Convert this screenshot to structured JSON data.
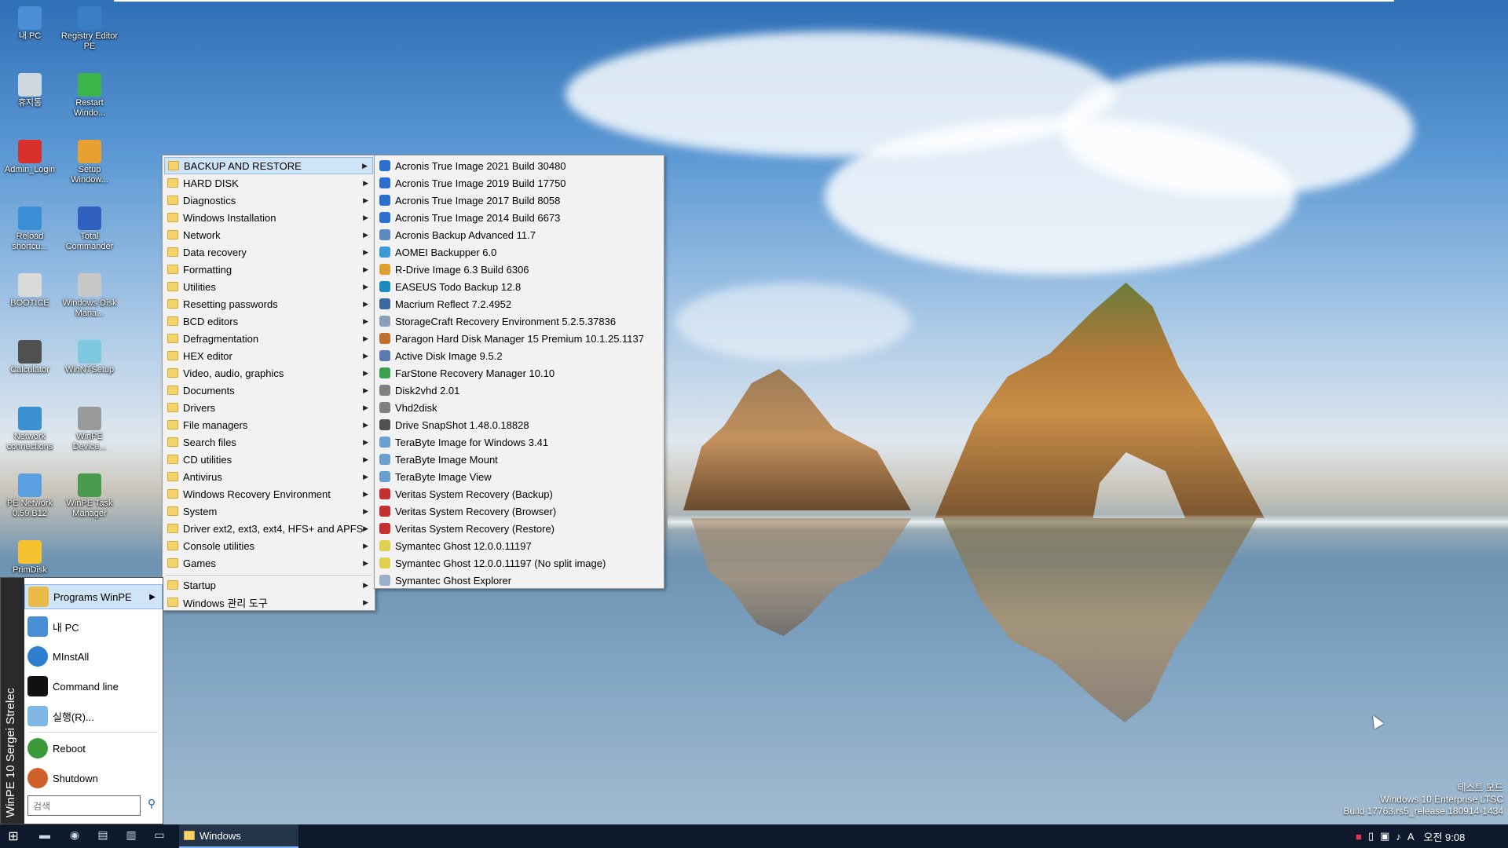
{
  "desktop": {
    "icons": [
      {
        "label": "내 PC",
        "icon": "computer-icon",
        "color": "#4a8fd6"
      },
      {
        "label": "Registry Editor PE",
        "icon": "registry-icon",
        "color": "#3a7fc4"
      },
      {
        "label": "휴지통",
        "icon": "recycle-bin-icon",
        "color": "#cfd8e0"
      },
      {
        "label": "Restart Windo...",
        "icon": "restart-icon",
        "color": "#3bb54a"
      },
      {
        "label": "Admin_Login",
        "icon": "admin-icon",
        "color": "#d9302c"
      },
      {
        "label": "Setup Window...",
        "icon": "setup-icon",
        "color": "#e8a030"
      },
      {
        "label": "Reload shortcu...",
        "icon": "reload-icon",
        "color": "#3a8fd6"
      },
      {
        "label": "Total Commander",
        "icon": "floppy-icon",
        "color": "#3060c0"
      },
      {
        "label": "BOOTICE",
        "icon": "bootice-icon",
        "color": "#dadada"
      },
      {
        "label": "Windows Disk Mana...",
        "icon": "disk-icon",
        "color": "#c8c8c8"
      },
      {
        "label": "Calculator",
        "icon": "calculator-icon",
        "color": "#505050"
      },
      {
        "label": "WinNTSetup",
        "icon": "winntsetup-icon",
        "color": "#7ec9e0"
      },
      {
        "label": "Network connections",
        "icon": "network-icon",
        "color": "#3a90d0"
      },
      {
        "label": "WinPE Device...",
        "icon": "device-icon",
        "color": "#9a9a9a"
      },
      {
        "label": "PE Network 0.59.B12",
        "icon": "pe-network-icon",
        "color": "#5a9fe0"
      },
      {
        "label": "WinPE Task Manager",
        "icon": "task-manager-icon",
        "color": "#4a9a50"
      },
      {
        "label": "PrimDisk",
        "icon": "cd-icon",
        "color": "#f5c330"
      }
    ]
  },
  "start_menu": {
    "side_label": "WinPE 10 Sergei Strelec",
    "items": [
      {
        "label": "Programs WinPE",
        "icon": "programs-icon"
      },
      {
        "label": "내 PC",
        "icon": "computer-icon"
      },
      {
        "label": "MInstAll",
        "icon": "minstall-icon"
      },
      {
        "label": "Command line",
        "icon": "cmd-icon"
      },
      {
        "label": "실행(R)...",
        "icon": "run-icon"
      },
      {
        "label": "Reboot",
        "icon": "reboot-icon"
      },
      {
        "label": "Shutdown",
        "icon": "shutdown-icon"
      }
    ],
    "search_placeholder": "검색"
  },
  "categories_menu": {
    "items": [
      "BACKUP AND RESTORE",
      "HARD DISK",
      "Diagnostics",
      "Windows Installation",
      "Network",
      "Data recovery",
      "Formatting",
      "Utilities",
      "Resetting passwords",
      "BCD editors",
      "Defragmentation",
      "HEX editor",
      "Video, audio, graphics",
      "Documents",
      "Drivers",
      "File managers",
      "Search files",
      "CD utilities",
      "Antivirus",
      "Windows Recovery Environment",
      "System",
      "Driver ext2, ext3, ext4, HFS+ and APFS",
      "Console utilities",
      "Games"
    ],
    "extra_items": [
      "Startup",
      "Windows 관리 도구"
    ]
  },
  "backup_menu": {
    "items": [
      {
        "label": "Acronis True Image 2021 Build 30480",
        "icon": "acronis-icon",
        "color": "#2a6fd0"
      },
      {
        "label": "Acronis True Image 2019 Build 17750",
        "icon": "acronis-icon",
        "color": "#2a6fd0"
      },
      {
        "label": "Acronis True Image 2017 Build 8058",
        "icon": "acronis-icon",
        "color": "#2a6fd0"
      },
      {
        "label": "Acronis True Image 2014 Build 6673",
        "icon": "acronis-icon",
        "color": "#2a6fd0"
      },
      {
        "label": "Acronis Backup Advanced 11.7",
        "icon": "acronis-backup-icon",
        "color": "#5a8ac0"
      },
      {
        "label": "AOMEI Backupper 6.0",
        "icon": "aomei-icon",
        "color": "#3a9ad6"
      },
      {
        "label": "R-Drive Image 6.3 Build 6306",
        "icon": "rdrive-icon",
        "color": "#e0a030"
      },
      {
        "label": "EASEUS Todo Backup 12.8",
        "icon": "easeus-icon",
        "color": "#1a8ac0"
      },
      {
        "label": "Macrium Reflect 7.2.4952",
        "icon": "macrium-icon",
        "color": "#3a6aa0"
      },
      {
        "label": "StorageCraft Recovery Environment 5.2.5.37836",
        "icon": "storagecraft-icon",
        "color": "#8aa0b8"
      },
      {
        "label": "Paragon Hard Disk Manager 15 Premium 10.1.25.1137",
        "icon": "paragon-icon",
        "color": "#c0702a"
      },
      {
        "label": "Active Disk Image 9.5.2",
        "icon": "active-disk-icon",
        "color": "#5a7ab0"
      },
      {
        "label": "FarStone Recovery Manager 10.10",
        "icon": "farstone-icon",
        "color": "#3aa050"
      },
      {
        "label": "Disk2vhd 2.01",
        "icon": "disk2vhd-icon",
        "color": "#808080"
      },
      {
        "label": "Vhd2disk",
        "icon": "vhd2disk-icon",
        "color": "#808080"
      },
      {
        "label": "Drive SnapShot 1.48.0.18828",
        "icon": "snapshot-icon",
        "color": "#505050"
      },
      {
        "label": "TeraByte Image for Windows 3.41",
        "icon": "terabyte-icon",
        "color": "#6aa0d0"
      },
      {
        "label": "TeraByte Image Mount",
        "icon": "terabyte-icon",
        "color": "#6aa0d0"
      },
      {
        "label": "TeraByte Image View",
        "icon": "terabyte-icon",
        "color": "#6aa0d0"
      },
      {
        "label": "Veritas System Recovery (Backup)",
        "icon": "veritas-icon",
        "color": "#c83030"
      },
      {
        "label": "Veritas System Recovery (Browser)",
        "icon": "veritas-icon",
        "color": "#c83030"
      },
      {
        "label": "Veritas System Recovery (Restore)",
        "icon": "veritas-icon",
        "color": "#c83030"
      },
      {
        "label": "Symantec Ghost 12.0.0.11197",
        "icon": "ghost-icon",
        "color": "#e0d050"
      },
      {
        "label": "Symantec Ghost 12.0.0.11197 (No split image)",
        "icon": "ghost-icon",
        "color": "#e0d050"
      },
      {
        "label": "Symantec Ghost Explorer",
        "icon": "ghost-explorer-icon",
        "color": "#9ab0c8"
      }
    ]
  },
  "taskbar": {
    "task_label": "Windows",
    "clock": "오전 9:08",
    "ime": "A"
  },
  "watermark": {
    "line1": "테스트 모드",
    "line2": "Windows 10 Enterprise LTSC",
    "line3": "Build 17763.rs5_release.180914-1434"
  }
}
